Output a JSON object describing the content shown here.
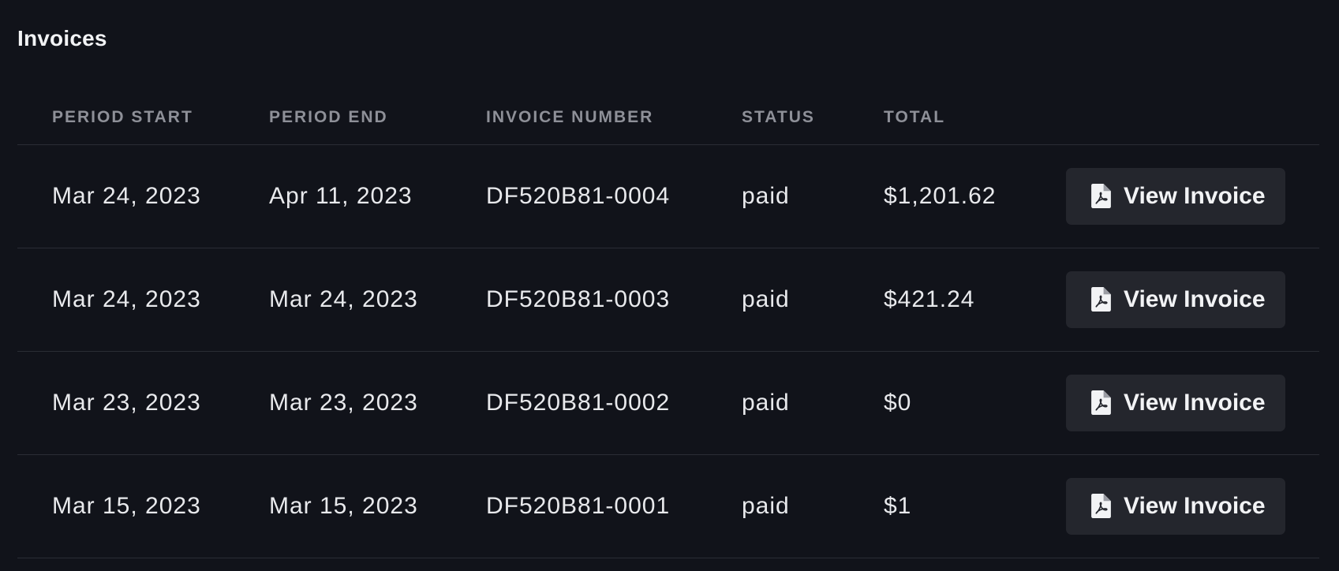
{
  "page": {
    "title": "Invoices"
  },
  "table": {
    "columns": [
      "PERIOD START",
      "PERIOD END",
      "INVOICE NUMBER",
      "STATUS",
      "TOTAL"
    ],
    "rows": [
      {
        "period_start": "Mar 24, 2023",
        "period_end": "Apr 11, 2023",
        "invoice_number": "DF520B81-0004",
        "status": "paid",
        "total": "$1,201.62",
        "action_label": "View Invoice"
      },
      {
        "period_start": "Mar 24, 2023",
        "period_end": "Mar 24, 2023",
        "invoice_number": "DF520B81-0003",
        "status": "paid",
        "total": "$421.24",
        "action_label": "View Invoice"
      },
      {
        "period_start": "Mar 23, 2023",
        "period_end": "Mar 23, 2023",
        "invoice_number": "DF520B81-0002",
        "status": "paid",
        "total": "$0",
        "action_label": "View Invoice"
      },
      {
        "period_start": "Mar 15, 2023",
        "period_end": "Mar 15, 2023",
        "invoice_number": "DF520B81-0001",
        "status": "paid",
        "total": "$1",
        "action_label": "View Invoice"
      }
    ]
  },
  "icons": {
    "view_invoice": "pdf-file-icon"
  },
  "colors": {
    "background": "#11131a",
    "button_bg": "#24262d",
    "header_text": "#8e9098",
    "divider": "#2a2d35"
  }
}
